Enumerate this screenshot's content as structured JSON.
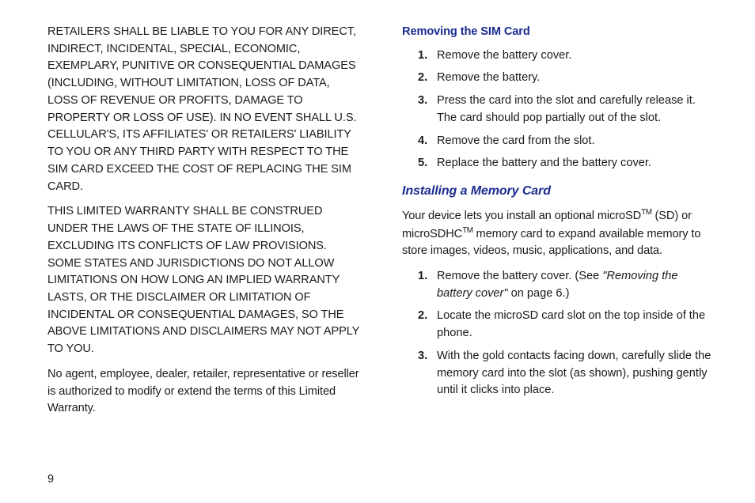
{
  "left": {
    "p1": "RETAILERS SHALL BE LIABLE TO YOU FOR ANY DIRECT, INDIRECT, INCIDENTAL, SPECIAL, ECONOMIC, EXEMPLARY, PUNITIVE OR CONSEQUENTIAL DAMAGES (INCLUDING, WITHOUT LIMITATION, LOSS OF DATA, LOSS OF REVENUE OR PROFITS, DAMAGE TO PROPERTY OR LOSS OF USE). IN NO EVENT SHALL U.S. CELLULAR'S, ITS AFFILIATES' OR RETAILERS' LIABILITY TO YOU OR ANY THIRD PARTY WITH RESPECT TO THE SIM CARD EXCEED THE COST OF REPLACING THE SIM CARD.",
    "p2": "THIS LIMITED WARRANTY SHALL BE CONSTRUED UNDER THE LAWS OF THE STATE OF ILLINOIS, EXCLUDING ITS CONFLICTS OF LAW PROVISIONS. SOME STATES AND JURISDICTIONS DO NOT ALLOW LIMITATIONS ON HOW LONG AN IMPLIED WARRANTY LASTS, OR THE DISCLAIMER OR LIMITATION OF INCIDENTAL OR CONSEQUENTIAL DAMAGES, SO THE ABOVE LIMITATIONS AND DISCLAIMERS MAY NOT APPLY TO YOU.",
    "p3": "No agent, employee, dealer, retailer, representative or reseller is authorized to modify or extend the terms of this Limited Warranty."
  },
  "right": {
    "section1": {
      "title": "Removing the SIM Card",
      "steps": [
        "Remove the battery cover.",
        "Remove the battery.",
        "Press the card into the slot and carefully release it. The card should pop partially out of the slot.",
        "Remove the card from the slot.",
        "Replace the battery and the battery cover."
      ]
    },
    "section2": {
      "title": "Installing a Memory Card",
      "intro_pre": "Your device lets you install an optional microSD",
      "intro_mid": " (SD) or microSDHC",
      "intro_post": " memory card to expand available memory to store images, videos, music, applications, and data.",
      "tm": "TM",
      "steps": [
        {
          "pre": "Remove the battery cover. (See ",
          "ital": "\"Removing the battery cover\"",
          "post": " on page 6.)"
        },
        {
          "text": "Locate the microSD card slot on the top inside of the phone."
        },
        {
          "text": "With the gold contacts facing down, carefully slide the memory card into the slot (as shown), pushing gently until it clicks into place."
        }
      ]
    }
  },
  "pagenum": "9"
}
